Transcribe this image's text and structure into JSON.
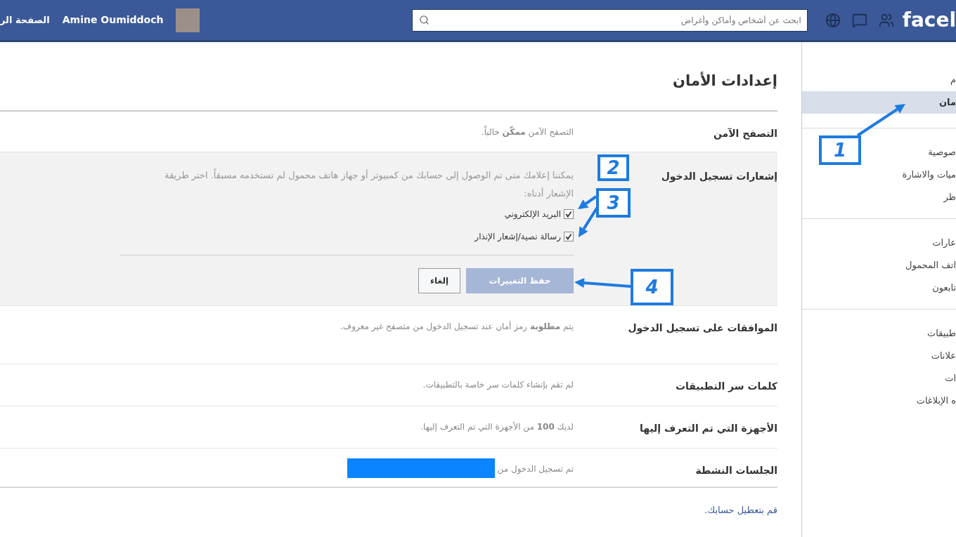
{
  "topbar": {
    "logo": "facel",
    "search": {
      "placeholder": "ابحث عن أشخاص وأماكن وأغراض"
    },
    "user_name": "Amine Oumiddoch",
    "home_link": "الصفحة الر"
  },
  "sidebar": {
    "groups": [
      {
        "items": [
          {
            "label": "م",
            "selected": false
          },
          {
            "label": "مان",
            "selected": true
          }
        ]
      },
      {
        "items": [
          {
            "label": "صوصية",
            "selected": false
          },
          {
            "label": "ميات والاشارة",
            "selected": false
          },
          {
            "label": "ظر",
            "selected": false
          }
        ]
      },
      {
        "items": [
          {
            "label": "عارات",
            "selected": false
          },
          {
            "label": "اتف المحمول",
            "selected": false
          },
          {
            "label": "تابعون",
            "selected": false
          }
        ]
      },
      {
        "items": [
          {
            "label": "طبيقات",
            "selected": false
          },
          {
            "label": "علانات",
            "selected": false
          },
          {
            "label": "ات",
            "selected": false
          },
          {
            "label": "ه الإبلاغات",
            "selected": false
          }
        ]
      }
    ]
  },
  "title": "إعدادات الأمان",
  "rows": [
    {
      "label": "التصفح الآمن",
      "value": "التصفح الآمن **ممكّن** حالياً.",
      "expanded": false
    },
    {
      "label": "إشعارات تسجيل الدخول",
      "expanded": true,
      "description": "يمكننا إعلامك متى تم الوصول إلى حسابك من كمبيوتر أو جهاز هاتف محمول لم تستخدمه مسبقاً. اختر طريقة الإشعار أدناه:",
      "options": [
        {
          "label": "البريد الإلكتروني",
          "checked": true
        },
        {
          "label": "رسالة نصية/إشعار الإنذار",
          "checked": true
        }
      ],
      "save_button": {
        "label": "حفظ التغييرات",
        "disabled": true
      },
      "cancel_button": {
        "label": "إلغاء"
      }
    },
    {
      "label": "الموافقات على تسجيل الدخول",
      "value": "يتم **مطلوبة** رمز أمان عند تسجيل الدخول من متصفح غير معروف.",
      "expanded": false
    },
    {
      "label": "كلمات سر التطبيقات",
      "value": "لم تقم بإنشاء كلمات سر خاصة بالتطبيقات.",
      "expanded": false
    },
    {
      "label": "الأجهزة التي تم التعرف إليها",
      "value": "لديك **100** من الأجهزة التي تم التعرف إليها.",
      "expanded": false
    },
    {
      "label": "الجلسات النشطة",
      "value": "تم تسجيل الدخول من",
      "expanded": false,
      "redacted": true
    }
  ],
  "deactivate_link": "قم بتعطيل حسابك.",
  "annotations": [
    {
      "label": "1"
    },
    {
      "label": "2"
    },
    {
      "label": "3"
    },
    {
      "label": "4"
    }
  ]
}
